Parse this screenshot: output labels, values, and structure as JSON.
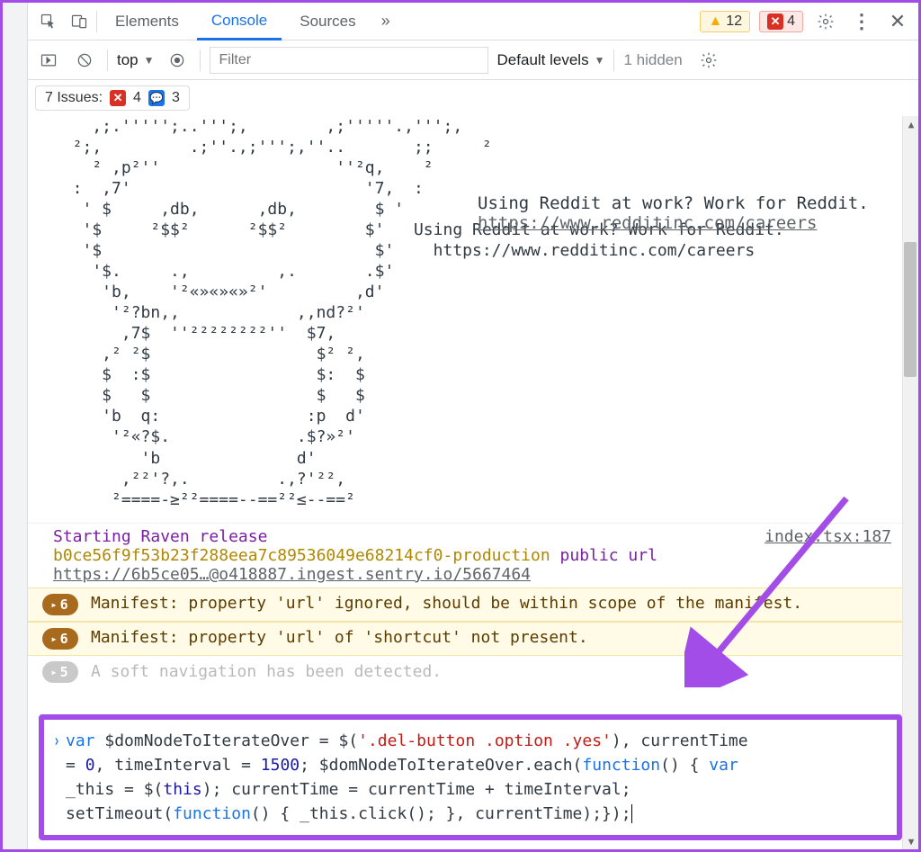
{
  "tabs": {
    "elements": "Elements",
    "console": "Console",
    "sources": "Sources",
    "more_glyph": "»"
  },
  "header_badges": {
    "warn_count": "12",
    "err_count": "4"
  },
  "filter_bar": {
    "context": "top",
    "filter_placeholder": "Filter",
    "levels_label": "Default levels",
    "hidden_label": "1 hidden"
  },
  "issues": {
    "label": "7 Issues:",
    "err_count": "4",
    "info_count": "3"
  },
  "ascii": {
    "art": "    ,;.''''';..''';,        ,;'''''.,''';,\n  ²;,         .;''.,;''';,''..       ;;     ²\n    ² ,p²''                  ''²q,    ²\n  :  ,7'                        '7,  :\n   ' $     ,db,      ,db,        $ '\n   '$     ²$$²      ²$$²        $'   Using Reddit at work? Work for Reddit.\n   '$                            $'    https://www.redditinc.com/careers\n    '$.     .,         ,.       .$'\n     'b,    '²«»«»«»²'         ,d'\n      '²?bn,,            ,,nd?²'\n       ,7$  ''²²²²²²²²''  $7,\n     ,² ²$                 $² ²,\n     $  :$                 $:  $\n     $   $                 $   $\n     'b  q:               :p  d'\n      '²«?$.             .$?»²'\n         'b              d'\n       ,²²'?,.         .,?'²²,\n      ²====-≥²²====--==²²≤--==²",
    "caption_line1": "Using Reddit at work? Work for Reddit.",
    "caption_link": "https://www.redditinc.com/careers"
  },
  "raven": {
    "header": "Starting Raven release",
    "hash": "b0ce56f9f53b23f288eea7c89536049e68214cf0-production",
    "tail": "public url",
    "sentry_link": "https://6b5ce05…@o418887.ingest.sentry.io/5667464",
    "src": "index.tsx:187"
  },
  "warnings": {
    "w1_count": "6",
    "w1_text": "Manifest: property 'url' ignored, should be within scope of the manifest.",
    "w2_count": "6",
    "w2_text": "Manifest: property 'url' of 'shortcut' not present.",
    "soft_count": "5",
    "soft_text": "A soft navigation has been detected."
  },
  "prompt_code": {
    "p1a": "var",
    "p1b": " $domNodeToIterateOver = $(",
    "p1c": "'.del-button .option .yes'",
    "p1d": "),   currentTime",
    "p2a": "= ",
    "p2b": "0",
    "p2c": ",   timeInterval = ",
    "p2d": "1500",
    "p2e": "; $domNodeToIterateOver.each(",
    "p2f": "function",
    "p2g": "() {   ",
    "p2h": "var",
    "p3a": " _this = $(",
    "p3b": "this",
    "p3c": ");  currentTime = currentTime + timeInterval;",
    "p4a": "setTimeout(",
    "p4b": "function",
    "p4c": "() {    _this.click();  }, currentTime);});"
  }
}
